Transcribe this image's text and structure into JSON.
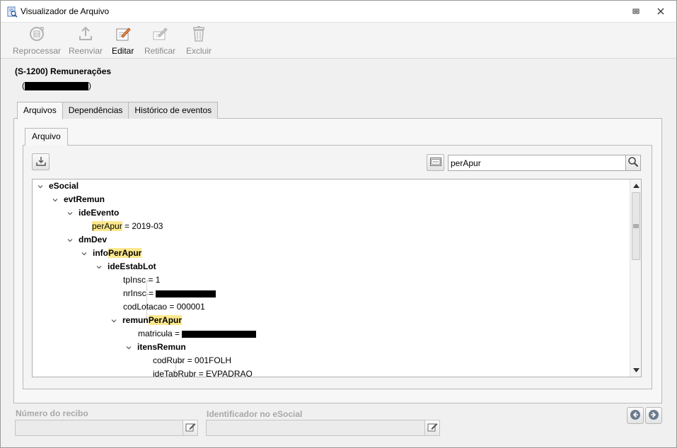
{
  "window": {
    "title": "Visualizador de Arquivo",
    "icons": {
      "app": "file-viewer-icon",
      "restore": "restore-icon",
      "close": "close-icon"
    }
  },
  "toolbar": {
    "reprocess_label": "Reprocessar",
    "resend_label": "Reenviar",
    "edit_label": "Editar",
    "rectify_label": "Retificar",
    "delete_label": "Excluir"
  },
  "event": {
    "title": "(S-1200) Remunerações",
    "subtitle_open": "(",
    "subtitle_close": ")"
  },
  "tabs": [
    {
      "label": "Arquivos",
      "active": true
    },
    {
      "label": "Dependências",
      "active": false
    },
    {
      "label": "Histórico de eventos",
      "active": false
    }
  ],
  "inner_tab": {
    "label": "Arquivo"
  },
  "search": {
    "value": "perApur",
    "placeholder": ""
  },
  "tree": [
    {
      "text": "eSocial",
      "type": "branch"
    },
    {
      "text": "evtRemun",
      "type": "branch"
    },
    {
      "text": "ideEvento",
      "type": "branch"
    },
    {
      "key": "perApur",
      "value": " = 2019-03",
      "type": "leaf",
      "highlight": "perApur"
    },
    {
      "text": "dmDev",
      "type": "branch"
    },
    {
      "prefix": "info",
      "highlight": "PerApur",
      "type": "branch"
    },
    {
      "text": "ideEstabLot",
      "type": "branch"
    },
    {
      "key": "tpInsc",
      "value": " = 1",
      "type": "leaf"
    },
    {
      "key": "nrInsc",
      "value": " = ",
      "type": "leaf",
      "redacted": true
    },
    {
      "key": "codLotacao",
      "value": " = 000001",
      "type": "leaf"
    },
    {
      "prefix": "remun",
      "highlight": "PerApur",
      "type": "branch"
    },
    {
      "key": "matricula",
      "value": " = ",
      "type": "leaf",
      "redacted": true
    },
    {
      "text": "itensRemun",
      "type": "branch"
    },
    {
      "key": "codRubr",
      "value": " = 001FOLH",
      "type": "leaf"
    },
    {
      "key": "ideTabRubr",
      "value": " = EVPADRAO",
      "type": "leaf"
    }
  ],
  "footer": {
    "receipt_label": "Número do recibo",
    "receipt_value": "",
    "esocial_id_label": "Identificador no eSocial",
    "esocial_id_value": ""
  },
  "colors": {
    "highlight": "#fbe88d",
    "disabled_text": "#8a8a8a",
    "window_bg": "#f0f0f0"
  }
}
